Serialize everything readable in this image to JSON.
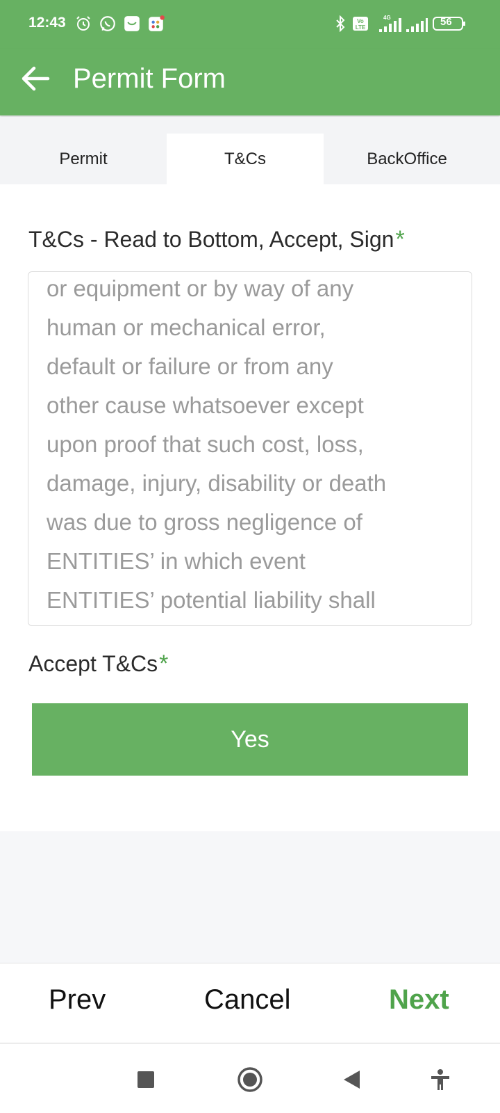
{
  "status_bar": {
    "time": "12:43",
    "icons": [
      "alarm-icon",
      "whatsapp-icon",
      "app-notification-icon",
      "app-notification-icon-2",
      "bluetooth-icon",
      "volte-icon",
      "signal-4g-icon",
      "signal-icon"
    ],
    "battery": "56",
    "network_label": "4G",
    "volte_label": "Vo LTE"
  },
  "app_bar": {
    "title": "Permit Form"
  },
  "tabs": [
    {
      "label": "Permit"
    },
    {
      "label": "T&Cs"
    },
    {
      "label": "BackOffice"
    }
  ],
  "form": {
    "tc_label": "T&Cs - Read to Bottom, Accept, Sign",
    "required_mark": "*",
    "tc_lines": [
      "or equipment or by way of any",
      "human or mechanical error,",
      "default or failure or from any",
      "other cause whatsoever except",
      "upon proof that such cost, loss,",
      "damage, injury, disability or death",
      "was due to gross negligence of",
      "ENTITIES’ in which event",
      "ENTITIES’ potential liability shall"
    ],
    "accept_label": "Accept T&Cs",
    "yes_label": "Yes"
  },
  "bottom_bar": {
    "prev": "Prev",
    "cancel": "Cancel",
    "next": "Next"
  },
  "colors": {
    "primary": "#67b162",
    "next_text": "#4fa34b",
    "tc_text": "#9a9a9a"
  }
}
